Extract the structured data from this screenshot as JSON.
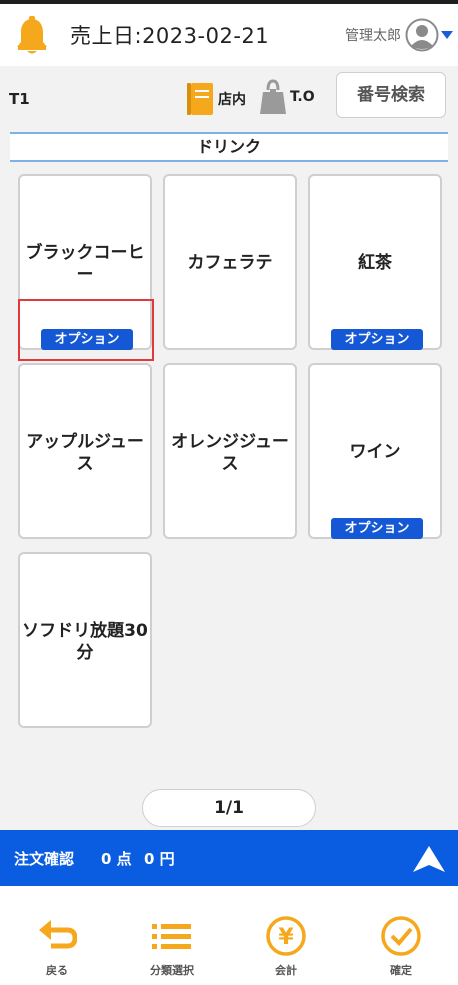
{
  "header": {
    "sales_date": "売上日:2023-02-21",
    "user_name": "管理太郎"
  },
  "table_bar": {
    "table_id": "T1",
    "eat_in_label": "店内",
    "takeout_label": "T.O",
    "number_search_label": "番号検索"
  },
  "category": {
    "title": "ドリンク"
  },
  "products": [
    {
      "name": "ブラックコーヒー",
      "badge": "オプション"
    },
    {
      "name": "カフェラテ",
      "badge": ""
    },
    {
      "name": "紅茶",
      "badge": "オプション"
    },
    {
      "name": "アップルジュース",
      "badge": ""
    },
    {
      "name": "オレンジジュース",
      "badge": ""
    },
    {
      "name": "ワイン",
      "badge": "オプション"
    },
    {
      "name": "ソフドリ放題30分",
      "badge": ""
    }
  ],
  "pager": {
    "label": "1/1"
  },
  "order": {
    "label": "注文確認",
    "count": "0 点",
    "amount": "0 円"
  },
  "footer": {
    "back_label": "戻る",
    "category_label": "分類選択",
    "checkout_label": "会計",
    "confirm_label": "確定"
  },
  "colors": {
    "accent_orange": "#f5a81c",
    "primary_blue": "#0a5de0",
    "badge_blue": "#1558d6",
    "highlight_red": "#e03a3a",
    "category_border": "#7fb0e8"
  },
  "icons": [
    "bell-icon",
    "user-avatar-icon",
    "chevron-down-icon",
    "notebook-icon",
    "takeout-bag-icon",
    "expand-up-icon",
    "back-arrow-icon",
    "list-icon",
    "yen-icon",
    "check-icon"
  ]
}
